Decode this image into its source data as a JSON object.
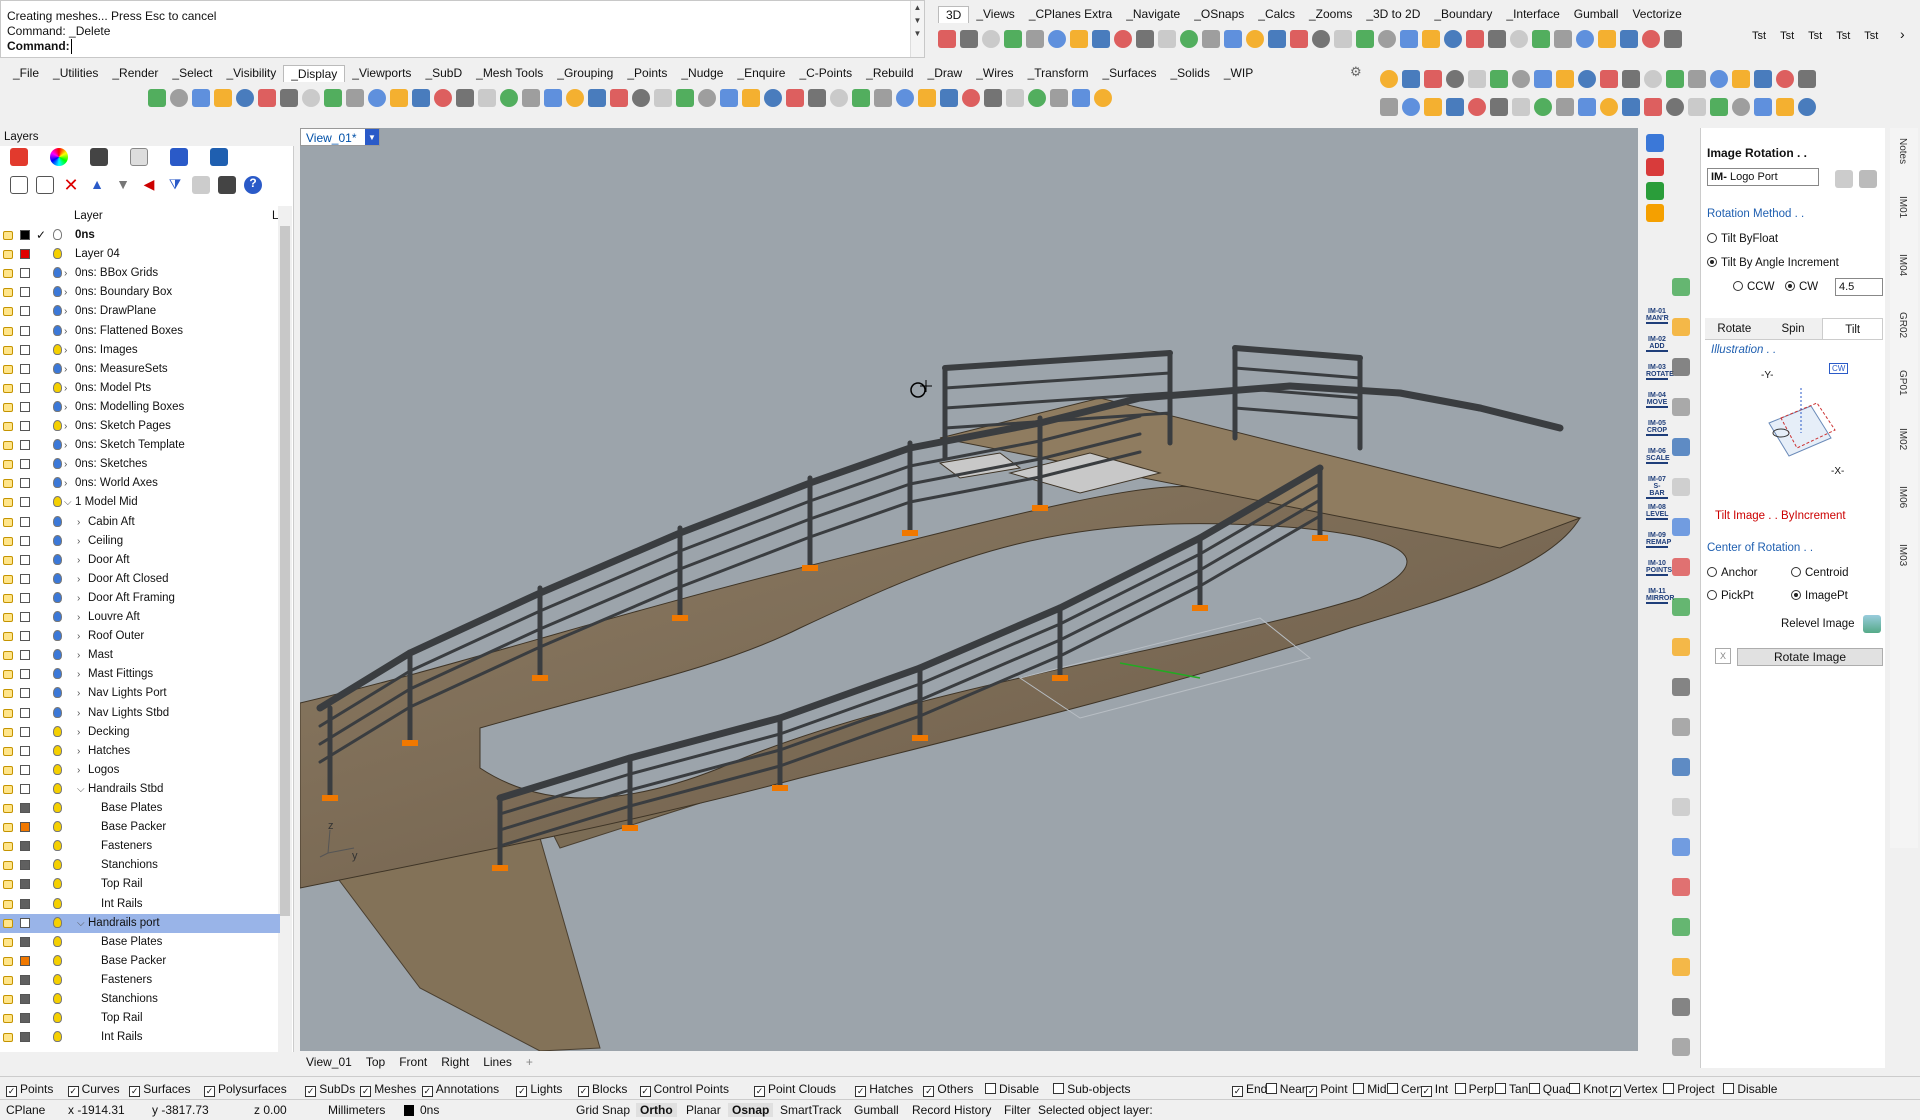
{
  "command": {
    "lines": [
      "Creating meshes... Press Esc to cancel",
      "Command: _Delete"
    ],
    "prompt_label": "Command:",
    "prompt_value": ""
  },
  "top_tabs": [
    "3D",
    "_Views",
    "_CPlanes Extra",
    "_Navigate",
    "_OSnaps",
    "_Calcs",
    "_Zooms",
    "_3D to 2D",
    "_Boundary",
    "_Interface",
    "Gumball",
    "Vectorize"
  ],
  "top_tabs_active": "3D",
  "main_tabs": [
    "_File",
    "_Utilities",
    "_Render",
    "_Select",
    "_Visibility",
    "_Display",
    "_Viewports",
    "_SubD",
    "_Mesh Tools",
    "_Grouping",
    "_Points",
    "_Nudge",
    "_Enquire",
    "_C-Points",
    "_Rebuild",
    "_Draw",
    "_Wires",
    "_Transform",
    "_Surfaces",
    "_Solids",
    "_WIP"
  ],
  "main_tabs_active": "_Display",
  "tst_labels": [
    "Tst",
    "Tst",
    "Tst",
    "Tst",
    "Tst"
  ],
  "layers": {
    "title": "Layers",
    "header_name": "Layer",
    "header_mat": "L",
    "rows": [
      {
        "name": "0ns",
        "indent": 0,
        "color": "#000000",
        "bulb": "#ffffff",
        "check": true,
        "bold": true,
        "chev": ""
      },
      {
        "name": "Layer 04",
        "indent": 0,
        "color": "#e00000",
        "bulb": "#f5d000",
        "chev": ""
      },
      {
        "name": "0ns: BBox Grids",
        "indent": 0,
        "color": "#ffffff",
        "bulb": "#3b78d8",
        "chev": ">"
      },
      {
        "name": "0ns: Boundary Box",
        "indent": 0,
        "color": "#ffffff",
        "bulb": "#3b78d8",
        "chev": ">"
      },
      {
        "name": "0ns: DrawPlane",
        "indent": 0,
        "color": "#ffffff",
        "bulb": "#3b78d8",
        "chev": ">"
      },
      {
        "name": "0ns: Flattened Boxes",
        "indent": 0,
        "color": "#ffffff",
        "bulb": "#3b78d8",
        "chev": ">"
      },
      {
        "name": "0ns: Images",
        "indent": 0,
        "color": "#ffffff",
        "bulb": "#f5d000",
        "chev": ">"
      },
      {
        "name": "0ns: MeasureSets",
        "indent": 0,
        "color": "#ffffff",
        "bulb": "#3b78d8",
        "chev": ">"
      },
      {
        "name": "0ns: Model Pts",
        "indent": 0,
        "color": "#ffffff",
        "bulb": "#f5d000",
        "chev": ">"
      },
      {
        "name": "0ns: Modelling Boxes",
        "indent": 0,
        "color": "#ffffff",
        "bulb": "#3b78d8",
        "chev": ">"
      },
      {
        "name": "0ns: Sketch Pages",
        "indent": 0,
        "color": "#ffffff",
        "bulb": "#f5d000",
        "chev": ">"
      },
      {
        "name": "0ns: Sketch Template",
        "indent": 0,
        "color": "#ffffff",
        "bulb": "#3b78d8",
        "chev": ">"
      },
      {
        "name": "0ns: Sketches",
        "indent": 0,
        "color": "#ffffff",
        "bulb": "#3b78d8",
        "chev": ">"
      },
      {
        "name": "0ns: World Axes",
        "indent": 0,
        "color": "#ffffff",
        "bulb": "#3b78d8",
        "chev": ">"
      },
      {
        "name": "1 Model Mid",
        "indent": 0,
        "color": "#ffffff",
        "bulb": "#f5d000",
        "chev": "v"
      },
      {
        "name": "Cabin Aft",
        "indent": 1,
        "color": "#ffffff",
        "bulb": "#3b78d8",
        "chev": ">"
      },
      {
        "name": "Ceiling",
        "indent": 1,
        "color": "#ffffff",
        "bulb": "#3b78d8",
        "chev": ">"
      },
      {
        "name": "Door Aft",
        "indent": 1,
        "color": "#ffffff",
        "bulb": "#3b78d8",
        "chev": ">"
      },
      {
        "name": "Door Aft Closed",
        "indent": 1,
        "color": "#ffffff",
        "bulb": "#3b78d8",
        "chev": ">"
      },
      {
        "name": "Door Aft Framing",
        "indent": 1,
        "color": "#ffffff",
        "bulb": "#3b78d8",
        "chev": ">"
      },
      {
        "name": "Louvre Aft",
        "indent": 1,
        "color": "#ffffff",
        "bulb": "#3b78d8",
        "chev": ">"
      },
      {
        "name": "Roof Outer",
        "indent": 1,
        "color": "#ffffff",
        "bulb": "#3b78d8",
        "chev": ">"
      },
      {
        "name": "Mast",
        "indent": 1,
        "color": "#ffffff",
        "bulb": "#3b78d8",
        "chev": ">"
      },
      {
        "name": "Mast Fittings",
        "indent": 1,
        "color": "#ffffff",
        "bulb": "#3b78d8",
        "chev": ">"
      },
      {
        "name": "Nav Lights Port",
        "indent": 1,
        "color": "#ffffff",
        "bulb": "#3b78d8",
        "chev": ">"
      },
      {
        "name": "Nav Lights Stbd",
        "indent": 1,
        "color": "#ffffff",
        "bulb": "#3b78d8",
        "chev": ">"
      },
      {
        "name": "Decking",
        "indent": 1,
        "color": "#ffffff",
        "bulb": "#f5d000",
        "chev": ">"
      },
      {
        "name": "Hatches",
        "indent": 1,
        "color": "#ffffff",
        "bulb": "#f5d000",
        "chev": ">"
      },
      {
        "name": "Logos",
        "indent": 1,
        "color": "#ffffff",
        "bulb": "#f5d000",
        "chev": ">"
      },
      {
        "name": "Handrails Stbd",
        "indent": 1,
        "color": "#ffffff",
        "bulb": "#f5d000",
        "chev": "v"
      },
      {
        "name": "Base Plates",
        "indent": 2,
        "color": "#606060",
        "bulb": "#f5d000",
        "chev": ""
      },
      {
        "name": "Base Packer",
        "indent": 2,
        "color": "#f07800",
        "bulb": "#f5d000",
        "chev": ""
      },
      {
        "name": "Fasteners",
        "indent": 2,
        "color": "#606060",
        "bulb": "#f5d000",
        "chev": ""
      },
      {
        "name": "Stanchions",
        "indent": 2,
        "color": "#606060",
        "bulb": "#f5d000",
        "chev": ""
      },
      {
        "name": "Top Rail",
        "indent": 2,
        "color": "#606060",
        "bulb": "#f5d000",
        "chev": ""
      },
      {
        "name": "Int Rails",
        "indent": 2,
        "color": "#606060",
        "bulb": "#f5d000",
        "chev": ""
      },
      {
        "name": "Handrails port",
        "indent": 1,
        "color": "#ffffff",
        "bulb": "#f5d000",
        "chev": "v",
        "selected": true
      },
      {
        "name": "Base Plates",
        "indent": 2,
        "color": "#606060",
        "bulb": "#f5d000",
        "chev": ""
      },
      {
        "name": "Base Packer",
        "indent": 2,
        "color": "#f07800",
        "bulb": "#f5d000",
        "chev": ""
      },
      {
        "name": "Fasteners",
        "indent": 2,
        "color": "#606060",
        "bulb": "#f5d000",
        "chev": ""
      },
      {
        "name": "Stanchions",
        "indent": 2,
        "color": "#606060",
        "bulb": "#f5d000",
        "chev": ""
      },
      {
        "name": "Top Rail",
        "indent": 2,
        "color": "#606060",
        "bulb": "#f5d000",
        "chev": ""
      },
      {
        "name": "Int Rails",
        "indent": 2,
        "color": "#606060",
        "bulb": "#f5d000",
        "chev": ""
      }
    ]
  },
  "viewport": {
    "title": "View_01*",
    "axis_z": "z",
    "axis_y": "y",
    "tabs": [
      "View_01",
      "Top",
      "Front",
      "Right",
      "Lines"
    ],
    "add_tab": "+"
  },
  "image_rotation": {
    "title": "Image Rotation . .",
    "im_prefix": "IM-",
    "im_value": "Logo Port",
    "method_label": "Rotation Method . .",
    "tilt_float": "Tilt ByFloat",
    "tilt_increment": "Tilt By Angle Increment",
    "ccw": "CCW",
    "cw": "CW",
    "increment_value": "4.5",
    "tabs": [
      "Rotate",
      "Spin",
      "Tilt"
    ],
    "active_tab": "Tilt",
    "illustration_label": "Illustration . .",
    "axis_y": "-Y-",
    "axis_x": "-X-",
    "cw_tag": "CW",
    "tilt_caption": "Tilt Image . . ByIncrement",
    "center_label": "Center of Rotation . .",
    "anchor": "Anchor",
    "centroid": "Centroid",
    "pickpt": "PickPt",
    "imagept": "ImagePt",
    "relevel": "Relevel Image",
    "close_x": "X",
    "rotate_button": "Rotate Image"
  },
  "side_buttons": [
    "IM-01\nMAN'R",
    "IM-02\nADD",
    "IM-03\nROTATE",
    "IM-04\nMOVE",
    "IM-05\nCROP",
    "IM-06\nSCALE",
    "IM-07\nS-BAR",
    "IM-08\nLEVEL",
    "IM-09\nREMAP",
    "IM-10\nPOINTS",
    "IM-11\nMIRROR"
  ],
  "right_vtabs": [
    "Notes",
    "IM01",
    "IM04",
    "GR02",
    "GP01",
    "IM02",
    "IM06",
    "IM03"
  ],
  "filters": [
    {
      "label": "Points",
      "checked": true
    },
    {
      "label": "Curves",
      "checked": true
    },
    {
      "label": "Surfaces",
      "checked": true
    },
    {
      "label": "Polysurfaces",
      "checked": true
    },
    {
      "label": "SubDs",
      "checked": true
    },
    {
      "label": "Meshes",
      "checked": true
    },
    {
      "label": "Annotations",
      "checked": true
    },
    {
      "label": "Lights",
      "checked": true
    },
    {
      "label": "Blocks",
      "checked": true
    },
    {
      "label": "Control Points",
      "checked": true
    },
    {
      "label": "Point Clouds",
      "checked": true
    },
    {
      "label": "Hatches",
      "checked": true
    },
    {
      "label": "Others",
      "checked": true
    },
    {
      "label": "Disable",
      "checked": false
    },
    {
      "label": "Sub-objects",
      "checked": false
    }
  ],
  "osnaps": [
    {
      "label": "End",
      "checked": true
    },
    {
      "label": "Near",
      "checked": false
    },
    {
      "label": "Point",
      "checked": true
    },
    {
      "label": "Mid",
      "checked": false
    },
    {
      "label": "Cen",
      "checked": false
    },
    {
      "label": "Int",
      "checked": true
    },
    {
      "label": "Perp",
      "checked": false
    },
    {
      "label": "Tan",
      "checked": false
    },
    {
      "label": "Quad",
      "checked": false
    },
    {
      "label": "Knot",
      "checked": false
    },
    {
      "label": "Vertex",
      "checked": true
    },
    {
      "label": "Project",
      "checked": false
    },
    {
      "label": "Disable",
      "checked": false
    }
  ],
  "status": {
    "cplane": "CPlane",
    "x": "x -1914.31",
    "y": "y -3817.73",
    "z": "z 0.00",
    "units": "Millimeters",
    "layer": "0ns",
    "grid_snap": "Grid Snap",
    "ortho": "Ortho",
    "planar": "Planar",
    "osnap": "Osnap",
    "smarttrack": "SmartTrack",
    "gumball": "Gumball",
    "record_history": "Record History",
    "filter": "Filter",
    "message": "Selected object layer:"
  },
  "colors": {
    "viewport_bg": "#9ca4ab",
    "deck": "#7a6a55",
    "deck_light": "#b3a48a",
    "rail": "#3a3d40",
    "packer": "#f07800",
    "selected_row": "#99b4e8"
  }
}
